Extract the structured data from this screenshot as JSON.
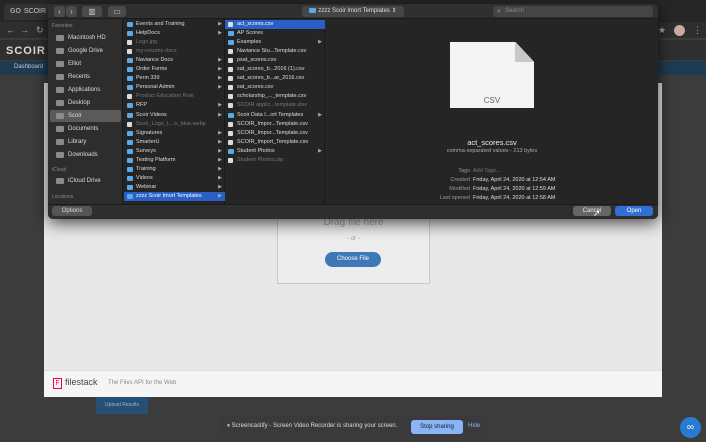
{
  "browser": {
    "tab_title": "SCOIR - E",
    "tab_prefix": "GO",
    "site_logo": "SCOIR",
    "site_nav": "Dashboard"
  },
  "dialog": {
    "path": "zzzz Scoir Imort Templates",
    "search_placeholder": "Search",
    "sidebar": {
      "favorites_heading": "Favorites",
      "items": [
        {
          "label": "Macintosh HD",
          "icon": "hard-drive-icon"
        },
        {
          "label": "Google Drive",
          "icon": "drive-icon"
        },
        {
          "label": "Elliot",
          "icon": "home-icon"
        },
        {
          "label": "Recents",
          "icon": "clock-icon"
        },
        {
          "label": "Applications",
          "icon": "applications-icon"
        },
        {
          "label": "Desktop",
          "icon": "desktop-icon"
        },
        {
          "label": "Scoir",
          "icon": "folder-icon",
          "selected": true
        },
        {
          "label": "Documents",
          "icon": "documents-icon"
        },
        {
          "label": "Library",
          "icon": "library-icon"
        },
        {
          "label": "Downloads",
          "icon": "downloads-icon"
        }
      ],
      "icloud_heading": "iCloud",
      "icloud_items": [
        {
          "label": "iCloud Drive",
          "icon": "cloud-icon"
        }
      ],
      "locations_heading": "Locations"
    },
    "column1": [
      {
        "label": "Events and Training",
        "type": "folder",
        "arrow": true
      },
      {
        "label": "HelpDocs",
        "type": "folder",
        "arrow": true
      },
      {
        "label": "Logo.jpg",
        "type": "file",
        "dim": true
      },
      {
        "label": "my-resume.docx",
        "type": "file",
        "dim": true
      },
      {
        "label": "Naviance Docs",
        "type": "folder",
        "arrow": true
      },
      {
        "label": "Order Forms",
        "type": "folder",
        "arrow": true
      },
      {
        "label": "Penn 339",
        "type": "folder",
        "arrow": true
      },
      {
        "label": "Personal Admin",
        "type": "folder",
        "arrow": true
      },
      {
        "label": "Product Education Role",
        "type": "file",
        "dim": true
      },
      {
        "label": "RFP",
        "type": "folder",
        "arrow": true
      },
      {
        "label": "Scoir Videos",
        "type": "folder",
        "arrow": true
      },
      {
        "label": "Scoir_Logo_L...e_blue.webp",
        "type": "file",
        "dim": true
      },
      {
        "label": "Signatures",
        "type": "folder",
        "arrow": true
      },
      {
        "label": "SmarterU",
        "type": "folder",
        "arrow": true
      },
      {
        "label": "Surveys",
        "type": "folder",
        "arrow": true
      },
      {
        "label": "Testing Platform",
        "type": "folder",
        "arrow": true
      },
      {
        "label": "Training",
        "type": "folder",
        "arrow": true
      },
      {
        "label": "Videos",
        "type": "folder",
        "arrow": true
      },
      {
        "label": "Webinar",
        "type": "folder",
        "arrow": true
      },
      {
        "label": "zzzz Scoir Imort Templates",
        "type": "folder",
        "arrow": true,
        "selected": true
      }
    ],
    "column2": [
      {
        "label": "act_scores.csv",
        "type": "file",
        "selected": true
      },
      {
        "label": "AP Scores",
        "type": "folder"
      },
      {
        "label": "Examples",
        "type": "folder",
        "arrow": true
      },
      {
        "label": "Naviance Stu...Template.csv",
        "type": "file"
      },
      {
        "label": "psat_scores.csv",
        "type": "file"
      },
      {
        "label": "sat_scores_b...2016 (1).csv",
        "type": "file"
      },
      {
        "label": "sat_scores_b...ar_2016.csv",
        "type": "file"
      },
      {
        "label": "sat_scores.csv",
        "type": "file"
      },
      {
        "label": "scholarship_..._template.csv",
        "type": "file"
      },
      {
        "label": "SCOIR applic...template.xlsx",
        "type": "file",
        "dim": true
      },
      {
        "label": "Scoir Data I...ort Templates",
        "type": "folder",
        "arrow": true
      },
      {
        "label": "SCOIR_Impor...Template.csv",
        "type": "file"
      },
      {
        "label": "SCOIR_Impor...Template.csv",
        "type": "file"
      },
      {
        "label": "SCOIR_Import_Template.csv",
        "type": "file"
      },
      {
        "label": "Student Photos",
        "type": "folder",
        "arrow": true
      },
      {
        "label": "Student Photos.zip",
        "type": "file",
        "dim": true
      }
    ],
    "preview": {
      "icon_label": "CSV",
      "file_name": "act_scores.csv",
      "file_kind": "comma-separated values - 213 bytes",
      "meta": [
        {
          "key": "Tags",
          "value": "Add Tags...",
          "placeholder": true
        },
        {
          "key": "Created",
          "value": "Friday, April 24, 2020 at 12:54 AM"
        },
        {
          "key": "Modified",
          "value": "Friday, April 24, 2020 at 12:59 AM"
        },
        {
          "key": "Last opened",
          "value": "Friday, April 24, 2020 at 12:58 AM"
        }
      ]
    },
    "buttons": {
      "options": "Options",
      "cancel": "Cancel",
      "open": "Open"
    }
  },
  "filestack": {
    "drag_text": "Drag file here",
    "or_text": "- or -",
    "choose_label": "Choose File",
    "logo_text": "filestack",
    "tagline": "The Files API for the Web",
    "behind_label": "Upload Results"
  },
  "share_bar": {
    "message": "Screencastify - Screen Video Recorder is sharing your screen.",
    "stop_label": "Stop sharing",
    "hide_label": "Hide"
  },
  "colors": {
    "accent": "#2a60c6",
    "open_button": "#2f6fd6",
    "choose_button": "#3e78b6",
    "stop_button": "#8ab4f8"
  }
}
